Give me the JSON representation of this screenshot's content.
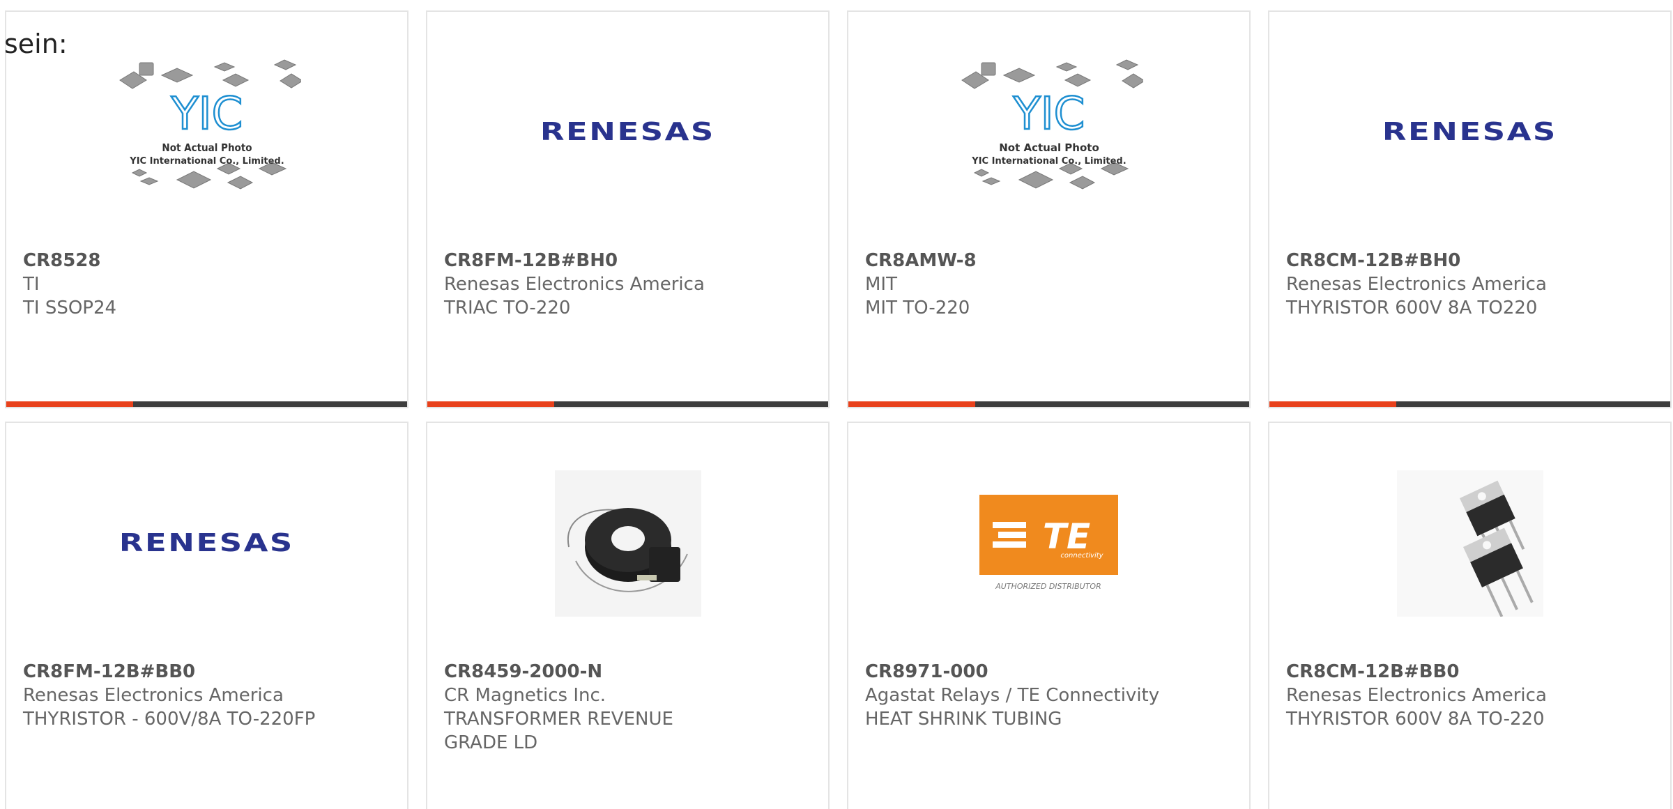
{
  "intro_text": "sein:",
  "yic": {
    "brand": "YIC",
    "line1": "Not Actual Photo",
    "line2": "YIC International Co., Limited."
  },
  "renesas_logo_text": "RENESAS",
  "te": {
    "logo_text": "TE",
    "sub_text": "connectivity",
    "caption": "AUTHORIZED DISTRIBUTOR"
  },
  "accent_colors": {
    "bar_accent": "#e8411c",
    "bar_base": "#3d3d3d",
    "renesas_blue": "#29338e",
    "te_orange": "#f08a1e"
  },
  "products": [
    {
      "image": "yic-placeholder",
      "part": "CR8528",
      "maker": "TI",
      "desc": "TI SSOP24"
    },
    {
      "image": "renesas-logo",
      "part": "CR8FM-12B#BH0",
      "maker": "Renesas Electronics America",
      "desc": "TRIAC TO-220"
    },
    {
      "image": "yic-placeholder",
      "part": "CR8AMW-8",
      "maker": "MIT",
      "desc": "MIT TO-220"
    },
    {
      "image": "renesas-logo",
      "part": "CR8CM-12B#BH0",
      "maker": "Renesas Electronics America",
      "desc": "THYRISTOR 600V 8A TO220"
    },
    {
      "image": "renesas-logo",
      "part": "CR8FM-12B#BB0",
      "maker": "Renesas Electronics America",
      "desc": "THYRISTOR - 600V/8A TO-220FP"
    },
    {
      "image": "current-transformer-photo",
      "part": "CR8459-2000-N",
      "maker": "CR Magnetics Inc.",
      "desc": "TRANSFORMER REVENUE GRADE LD"
    },
    {
      "image": "te-connectivity-logo",
      "part": "CR8971-000",
      "maker": "Agastat Relays / TE Connectivity",
      "desc": "HEAT SHRINK TUBING"
    },
    {
      "image": "to220-transistor-photo",
      "part": "CR8CM-12B#BB0",
      "maker": "Renesas Electronics America",
      "desc": "THYRISTOR 600V 8A TO-220"
    }
  ]
}
